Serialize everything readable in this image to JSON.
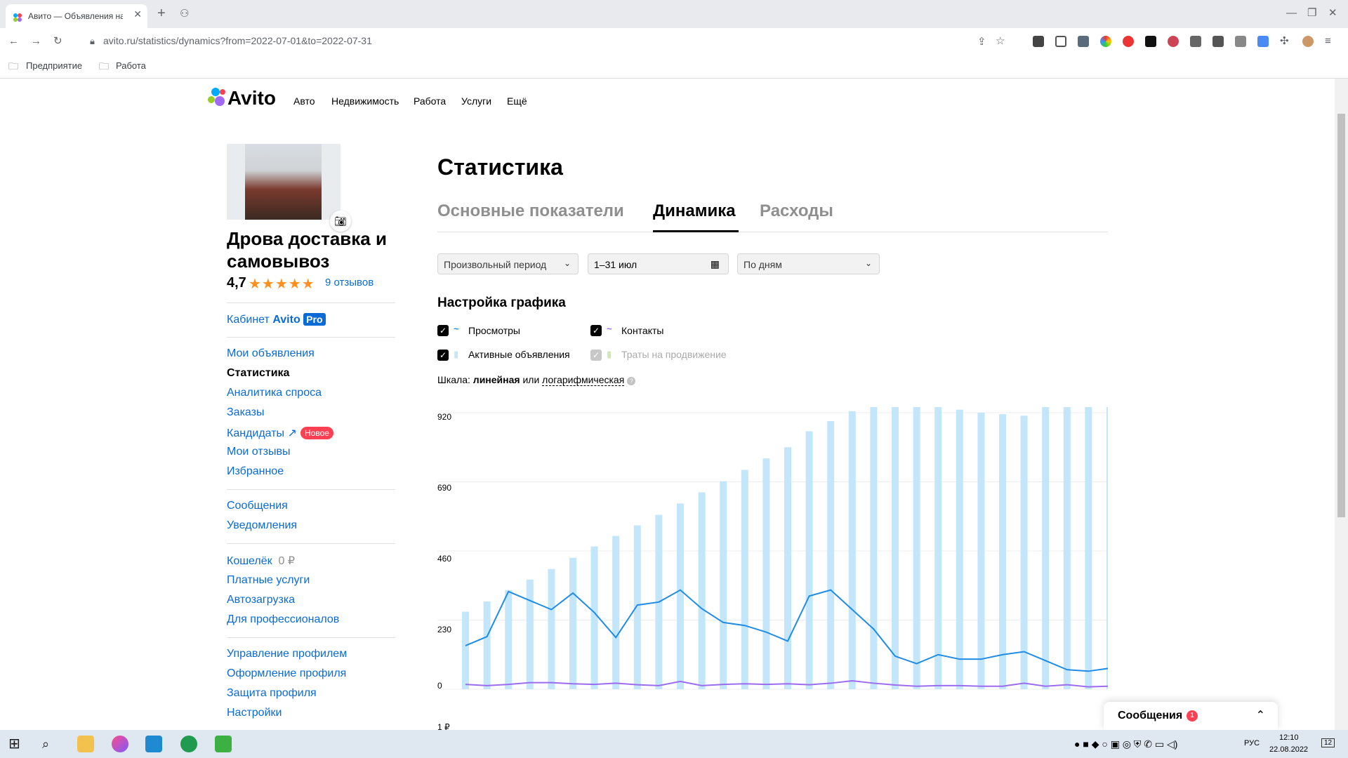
{
  "browser": {
    "tab_title": "Авито — Объявления на сайт",
    "url": "avito.ru/statistics/dynamics?from=2022-07-01&to=2022-07-31",
    "bookmarks": [
      "Предприятие",
      "Работа"
    ]
  },
  "site": {
    "logo": "Avito",
    "nav": [
      "Авто",
      "Недвижимость",
      "Работа",
      "Услуги",
      "Ещё"
    ]
  },
  "profile": {
    "name": "Дрова доставка и самовывоз",
    "rating": "4,7",
    "reviews": "9 отзывов",
    "cabinet": "Кабинет",
    "cabinet_brand": "Avito",
    "cabinet_pro": "Pro"
  },
  "sidebar": {
    "group1": [
      "Мои объявления",
      "Статистика",
      "Аналитика спроса",
      "Заказы",
      "Кандидаты ↗",
      "Мои отзывы",
      "Избранное"
    ],
    "new_badge": "Новое",
    "group2": [
      "Сообщения",
      "Уведомления"
    ],
    "wallet": "Кошелёк",
    "wallet_amount": "0 ₽",
    "group3": [
      "Платные услуги",
      "Автозагрузка",
      "Для профессионалов"
    ],
    "group4": [
      "Управление профилем",
      "Оформление профиля",
      "Защита профиля",
      "Настройки"
    ]
  },
  "main": {
    "title": "Статистика",
    "tabs": [
      "Основные показатели",
      "Динамика",
      "Расходы"
    ],
    "period_select": "Произвольный период",
    "date_range": "1–31 июл",
    "grouping_select": "По дням",
    "graph_settings": "Настройка графика",
    "series": {
      "views": "Просмотры",
      "contacts": "Контакты",
      "active": "Активные объявления",
      "promo": "Траты на продвижение"
    },
    "scale_label": "Шкала:",
    "scale_linear": "линейная",
    "scale_or": "или",
    "scale_log": "логарифмическая",
    "below_chart": "1 ₽"
  },
  "messages_popup": {
    "label": "Сообщения",
    "count": "1"
  },
  "taskbar": {
    "lang": "РУС",
    "time": "12:10",
    "date": "22.08.2022",
    "notif": "12"
  },
  "chart_data": {
    "type": "bar",
    "yticks": [
      "920",
      "690",
      "460",
      "230",
      "0"
    ],
    "ylim": [
      0,
      920
    ],
    "series": [
      {
        "name": "Активные объявления",
        "type": "bar",
        "values": [
          258,
          292,
          330,
          365,
          400,
          437,
          475,
          510,
          545,
          580,
          618,
          655,
          692,
          730,
          768,
          805,
          858,
          892,
          925,
          950,
          950,
          950,
          950,
          930,
          920,
          915,
          910,
          950,
          950,
          950,
          950,
          950
        ]
      },
      {
        "name": "Просмотры",
        "type": "line",
        "values": [
          145,
          175,
          325,
          295,
          265,
          320,
          255,
          172,
          280,
          290,
          330,
          268,
          222,
          212,
          190,
          160,
          310,
          330,
          265,
          200,
          110,
          85,
          115,
          100,
          100,
          115,
          125,
          95,
          65,
          60,
          70
        ]
      },
      {
        "name": "Контакты",
        "type": "line",
        "values": [
          16,
          12,
          16,
          22,
          22,
          18,
          16,
          20,
          15,
          12,
          26,
          12,
          16,
          18,
          16,
          18,
          15,
          20,
          28,
          20,
          14,
          10,
          12,
          12,
          10,
          10,
          20,
          10,
          15,
          8,
          10
        ]
      }
    ],
    "colors": {
      "bars": "#c4e6fb",
      "views": "#1f8ce6",
      "contacts": "#9c6cf0"
    }
  }
}
